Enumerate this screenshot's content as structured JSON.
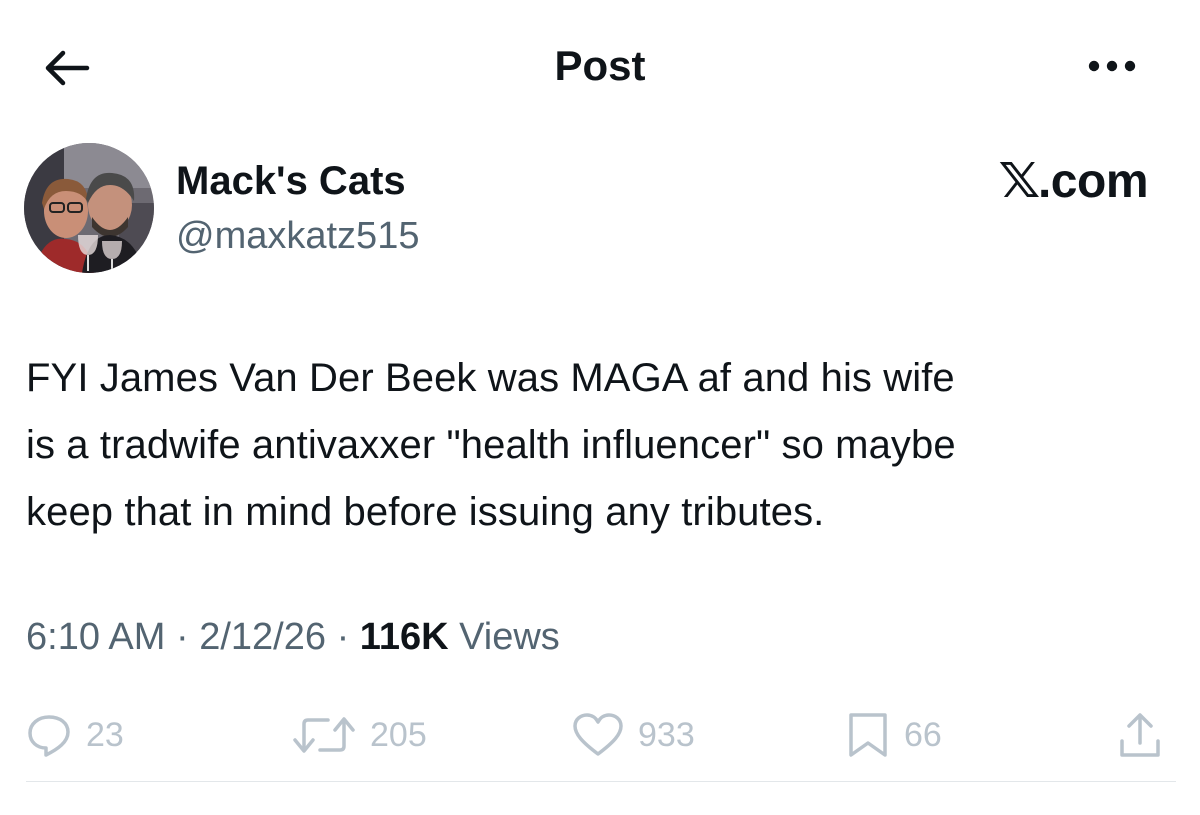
{
  "header": {
    "title": "Post",
    "back_icon": "arrow-left-icon",
    "more_icon": "more-horizontal-icon"
  },
  "author": {
    "display_name": "Mack's Cats",
    "handle": "@maxkatz515",
    "avatar": "profile-photo"
  },
  "brand": {
    "x_glyph": "𝕏",
    "domain": ".com"
  },
  "post": {
    "lines": [
      "FYI James Van Der Beek was MAGA af and his wife",
      "is a tradwife antivaxxer \"health influencer\" so maybe",
      "keep that in mind before issuing any tributes."
    ],
    "time": "6:10 AM",
    "date": "2/12/26",
    "sep": "·",
    "views_count": "116K",
    "views_label": "Views"
  },
  "actions": {
    "replies": "23",
    "reposts": "205",
    "likes": "933",
    "bookmarks": "66"
  },
  "colors": {
    "text": "#0f1419",
    "secondary": "#536471",
    "faded_icon": "#b9c3cc"
  }
}
